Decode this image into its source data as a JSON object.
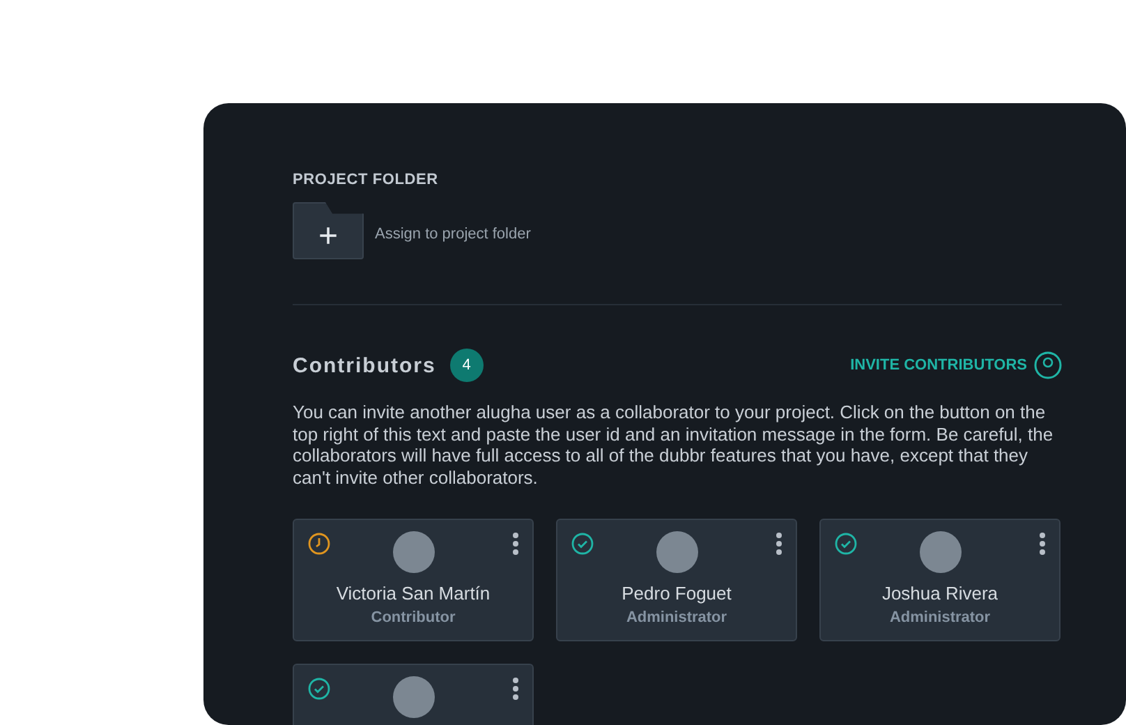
{
  "project_folder": {
    "heading": "PROJECT FOLDER",
    "action": "Assign to project folder",
    "icon_glyph": "+"
  },
  "contributors": {
    "title": "Contributors",
    "count": "4",
    "invite_label": "INVITE CONTRIBUTORS",
    "description": "You can invite another alugha user as a collaborator to your project. Click on the button on the top right of this text and paste the user id and an invitation message in the form. Be careful, the collaborators will have full access to all of the dubbr features that you have, except that they can't invite other collaborators.",
    "members": [
      {
        "name": "Victoria San Martín",
        "role": "Contributor",
        "kind": "pending"
      },
      {
        "name": "Pedro Foguet",
        "role": "Administrator",
        "kind": "accepted"
      },
      {
        "name": "Joshua Rivera",
        "role": "Administrator",
        "kind": "accepted"
      },
      {
        "kind": "accepted"
      }
    ]
  }
}
